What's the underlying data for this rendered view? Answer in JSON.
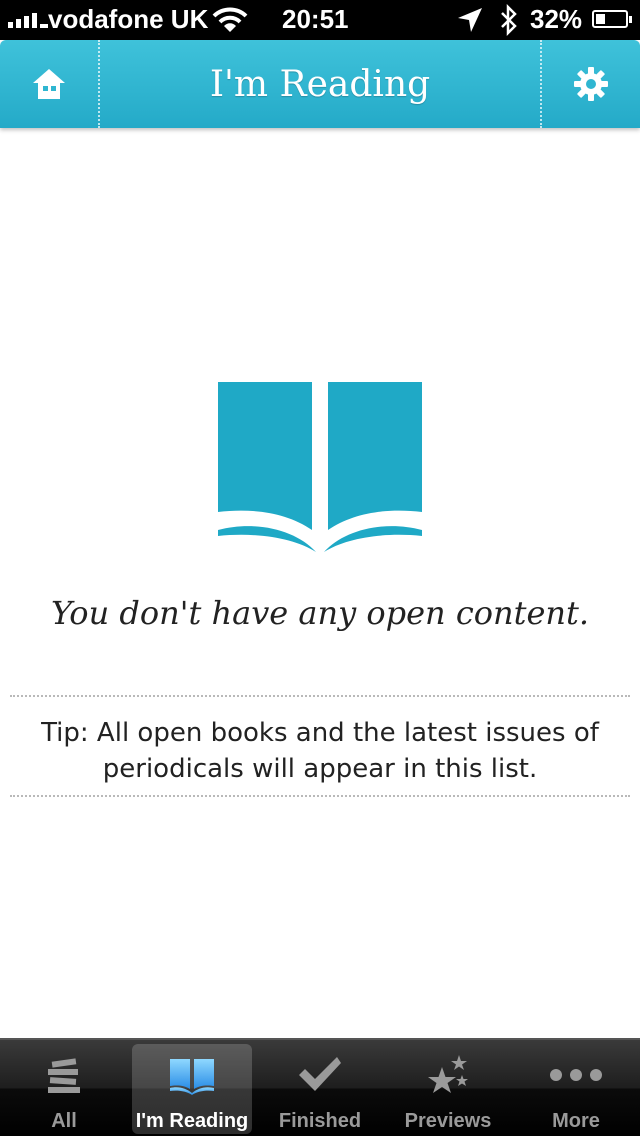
{
  "status_bar": {
    "carrier": "vodafone UK",
    "time": "20:51",
    "battery_percent": "32%",
    "battery_level": 0.32,
    "icons": [
      "signal-icon",
      "wifi-icon",
      "location-icon",
      "bluetooth-icon",
      "battery-icon"
    ]
  },
  "nav": {
    "title": "I'm Reading",
    "left_icon": "home-icon",
    "right_icon": "gear-icon"
  },
  "empty_state": {
    "icon": "open-book-icon",
    "message": "You don't have any open content.",
    "tip": "Tip: All open books and the latest issues of periodicals will appear in this list."
  },
  "tabs": [
    {
      "label": "All",
      "icon": "stack-icon",
      "active": false
    },
    {
      "label": "I'm Reading",
      "icon": "open-book-icon",
      "active": true
    },
    {
      "label": "Finished",
      "icon": "checkmark-icon",
      "active": false
    },
    {
      "label": "Previews",
      "icon": "stars-icon",
      "active": false
    },
    {
      "label": "More",
      "icon": "more-dots-icon",
      "active": false
    }
  ],
  "colors": {
    "accent": "#1fa9c6",
    "nav_bg": "#2fb6d1",
    "tab_active": "#ffffff",
    "tab_inactive": "#9a9a9a"
  }
}
